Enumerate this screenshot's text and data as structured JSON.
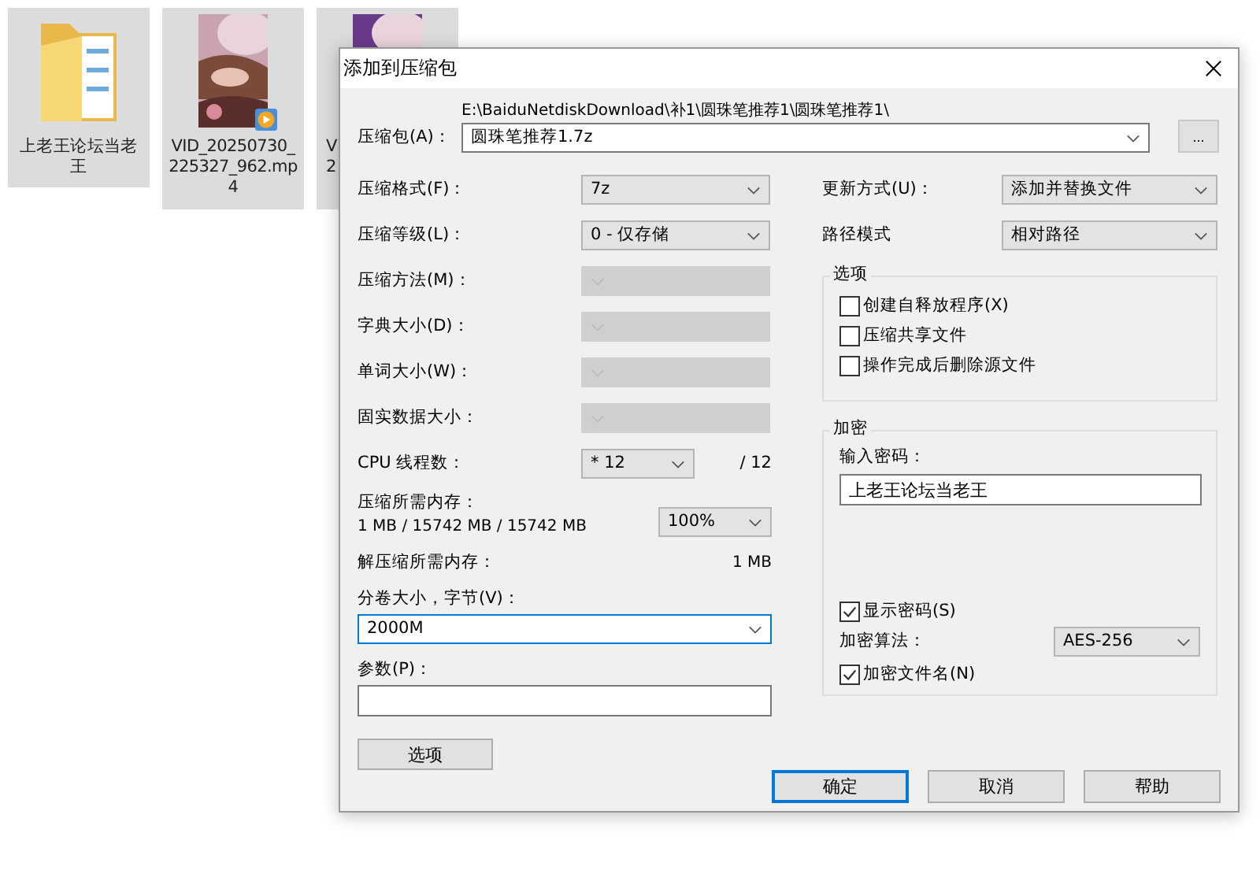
{
  "desktop_icons": [
    {
      "kind": "folder",
      "selected": true,
      "label_lines": [
        "上老王论坛当老",
        "王"
      ]
    },
    {
      "kind": "video",
      "selected": true,
      "label_lines": [
        "VID_20250730_",
        "225327_962.mp",
        "4"
      ]
    },
    {
      "kind": "thumbnail",
      "selected": true,
      "label_lines": [
        "V",
        "2"
      ]
    }
  ],
  "dialog": {
    "title": "添加到压缩包",
    "archive": {
      "label": "压缩包(A)：",
      "path": "E:\\BaiduNetdiskDownload\\补1\\圆珠笔推荐1\\圆珠笔推荐1\\",
      "value": "圆珠笔推荐1.7z",
      "browse": "..."
    },
    "left_fields": [
      {
        "label": "压缩格式(F)：",
        "value": "7z",
        "disabled": false
      },
      {
        "label": "压缩等级(L)：",
        "value": "0 - 仅存储",
        "disabled": false
      },
      {
        "label": "压缩方法(M)：",
        "disabled": true
      },
      {
        "label": "字典大小(D)：",
        "disabled": true
      },
      {
        "label": "单词大小(W)：",
        "disabled": true
      },
      {
        "label": "固实数据大小：",
        "disabled": true
      }
    ],
    "cpu": {
      "label": "CPU 线程数：",
      "value": "* 12",
      "max": "/ 12"
    },
    "memory": {
      "label": "压缩所需内存：",
      "value": "1 MB / 15742 MB / 15742 MB",
      "percent": "100%"
    },
    "decompress_memory": {
      "label": "解压缩所需内存：",
      "value": "1 MB"
    },
    "volume": {
      "label": "分卷大小，字节(V)：",
      "value": "2000M"
    },
    "params": {
      "label": "参数(P)："
    },
    "options_button": "选项",
    "update_mode": {
      "label": "更新方式(U)：",
      "value": "添加并替换文件"
    },
    "path_mode": {
      "label": "路径模式",
      "value": "相对路径"
    },
    "options_group": {
      "title": "选项",
      "checkboxes": [
        {
          "label": "创建自释放程序(X)",
          "checked": false
        },
        {
          "label": "压缩共享文件",
          "checked": false
        },
        {
          "label": "操作完成后删除源文件",
          "checked": false
        }
      ]
    },
    "encryption": {
      "title": "加密",
      "password_label": "输入密码：",
      "password": "上老王论坛当老王",
      "show_password": {
        "label": "显示密码(S)",
        "checked": true
      },
      "method": {
        "label": "加密算法：",
        "value": "AES-256"
      },
      "encrypt_names": {
        "label": "加密文件名(N)",
        "checked": true
      }
    },
    "buttons": [
      {
        "label": "确定",
        "focused": true
      },
      {
        "label": "取消",
        "focused": false
      },
      {
        "label": "帮助",
        "focused": false
      }
    ]
  }
}
